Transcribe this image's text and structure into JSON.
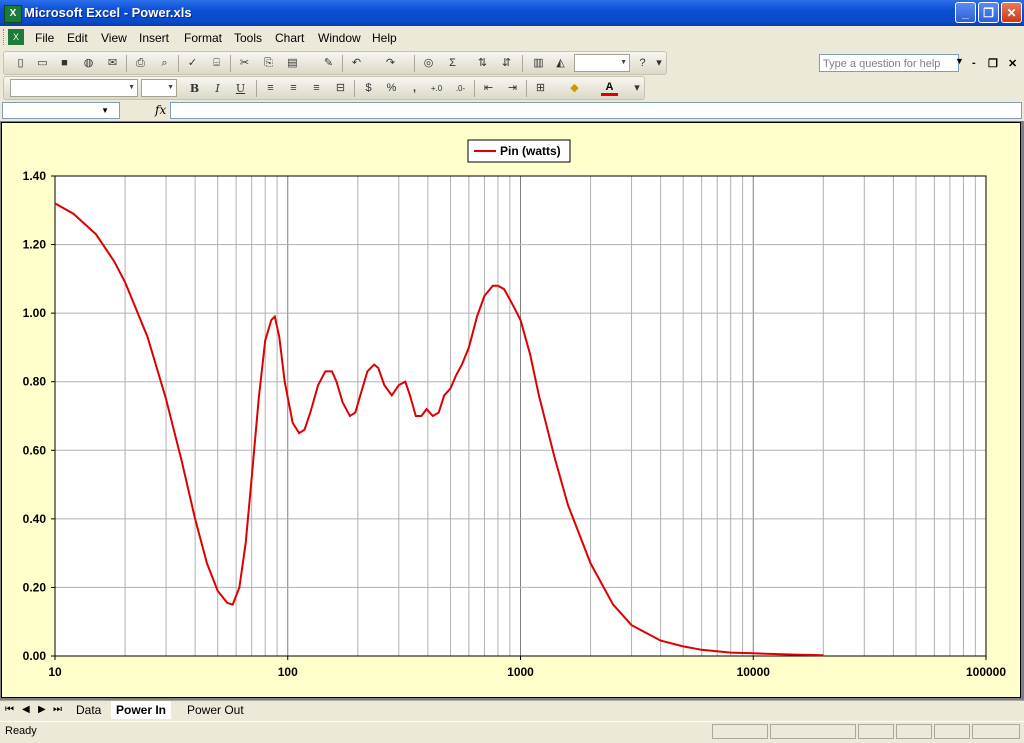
{
  "window": {
    "title": "Microsoft Excel - Power.xls",
    "controls": {
      "minimize": "_",
      "restore": "❐",
      "close": "✕"
    }
  },
  "menubar": {
    "items": [
      {
        "label": "File"
      },
      {
        "label": "Edit"
      },
      {
        "label": "View"
      },
      {
        "label": "Insert"
      },
      {
        "label": "Format"
      },
      {
        "label": "Tools"
      },
      {
        "label": "Chart"
      },
      {
        "label": "Window"
      },
      {
        "label": "Help"
      }
    ],
    "help_placeholder": "Type a question for help"
  },
  "toolbar": {
    "autosum": "Σ",
    "bold": "B",
    "italic": "I",
    "underline": "U",
    "currency": "$",
    "percent": "%",
    "comma": ",",
    "font_color_glyph": "A"
  },
  "formula_bar": {
    "fx": "fx"
  },
  "sheet_tabs": {
    "tabs": [
      {
        "label": "Data"
      },
      {
        "label": "Power In",
        "active": true
      },
      {
        "label": "Power Out"
      }
    ]
  },
  "status": {
    "text": "Ready"
  },
  "chart_data": {
    "type": "line",
    "xscale": "log",
    "xlim": [
      10,
      100000
    ],
    "ylim": [
      0.0,
      1.4
    ],
    "grid": true,
    "legend": "top-center",
    "x_ticks": [
      "10",
      "100",
      "1000",
      "10000",
      "100000"
    ],
    "y_ticks": [
      "0.00",
      "0.20",
      "0.40",
      "0.60",
      "0.80",
      "1.00",
      "1.20",
      "1.40"
    ],
    "series": [
      {
        "name": "Pin (watts)",
        "color": "#dd0000",
        "x": [
          10,
          12,
          15,
          18,
          20,
          25,
          30,
          35,
          40,
          45,
          50,
          55,
          58,
          62,
          66,
          70,
          75,
          80,
          85,
          88,
          92,
          97,
          105,
          112,
          118,
          125,
          135,
          145,
          155,
          162,
          172,
          185,
          195,
          205,
          220,
          235,
          245,
          260,
          280,
          300,
          320,
          335,
          355,
          375,
          395,
          420,
          445,
          470,
          500,
          530,
          560,
          600,
          650,
          700,
          760,
          800,
          850,
          900,
          950,
          1000,
          1100,
          1200,
          1400,
          1600,
          2000,
          2500,
          3000,
          4000,
          5000,
          6000,
          8000,
          10000,
          15000,
          20000
        ],
        "y": [
          1.32,
          1.29,
          1.23,
          1.15,
          1.09,
          0.93,
          0.75,
          0.57,
          0.4,
          0.27,
          0.19,
          0.155,
          0.15,
          0.2,
          0.33,
          0.52,
          0.75,
          0.92,
          0.98,
          0.99,
          0.93,
          0.8,
          0.68,
          0.65,
          0.66,
          0.71,
          0.79,
          0.83,
          0.83,
          0.8,
          0.74,
          0.7,
          0.71,
          0.76,
          0.83,
          0.85,
          0.84,
          0.79,
          0.76,
          0.79,
          0.8,
          0.76,
          0.7,
          0.7,
          0.72,
          0.7,
          0.71,
          0.76,
          0.78,
          0.82,
          0.85,
          0.9,
          0.99,
          1.05,
          1.08,
          1.08,
          1.07,
          1.04,
          1.01,
          0.98,
          0.88,
          0.76,
          0.58,
          0.44,
          0.27,
          0.15,
          0.09,
          0.045,
          0.028,
          0.018,
          0.01,
          0.008,
          0.004,
          0.002
        ]
      }
    ]
  }
}
